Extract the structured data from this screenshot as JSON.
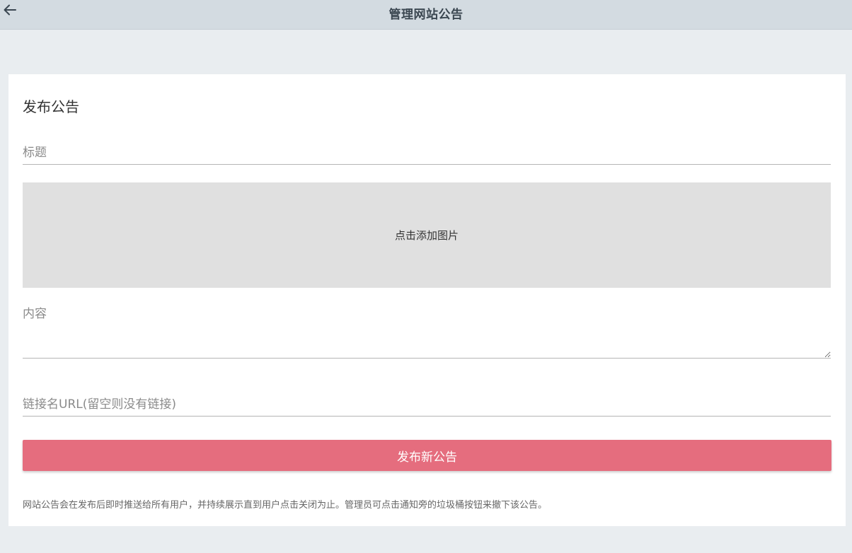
{
  "header": {
    "title": "管理网站公告",
    "back_icon": "arrow-left-icon"
  },
  "form": {
    "heading": "发布公告",
    "title_placeholder": "标题",
    "title_value": "",
    "image_upload_label": "点击添加图片",
    "content_placeholder": "内容",
    "content_value": "",
    "link_placeholder": "链接名URL(留空则没有链接)",
    "link_value": "",
    "submit_label": "发布新公告",
    "notice": "网站公告会在发布后即时推送给所有用户，并持续展示直到用户点击关闭为止。管理员可点击通知旁的垃圾桶按钮来撤下该公告。"
  },
  "colors": {
    "header_bg": "#d3dbe1",
    "page_bg": "#e9edf0",
    "accent": "#e56d7e",
    "upload_bg": "#e0e0e0"
  }
}
